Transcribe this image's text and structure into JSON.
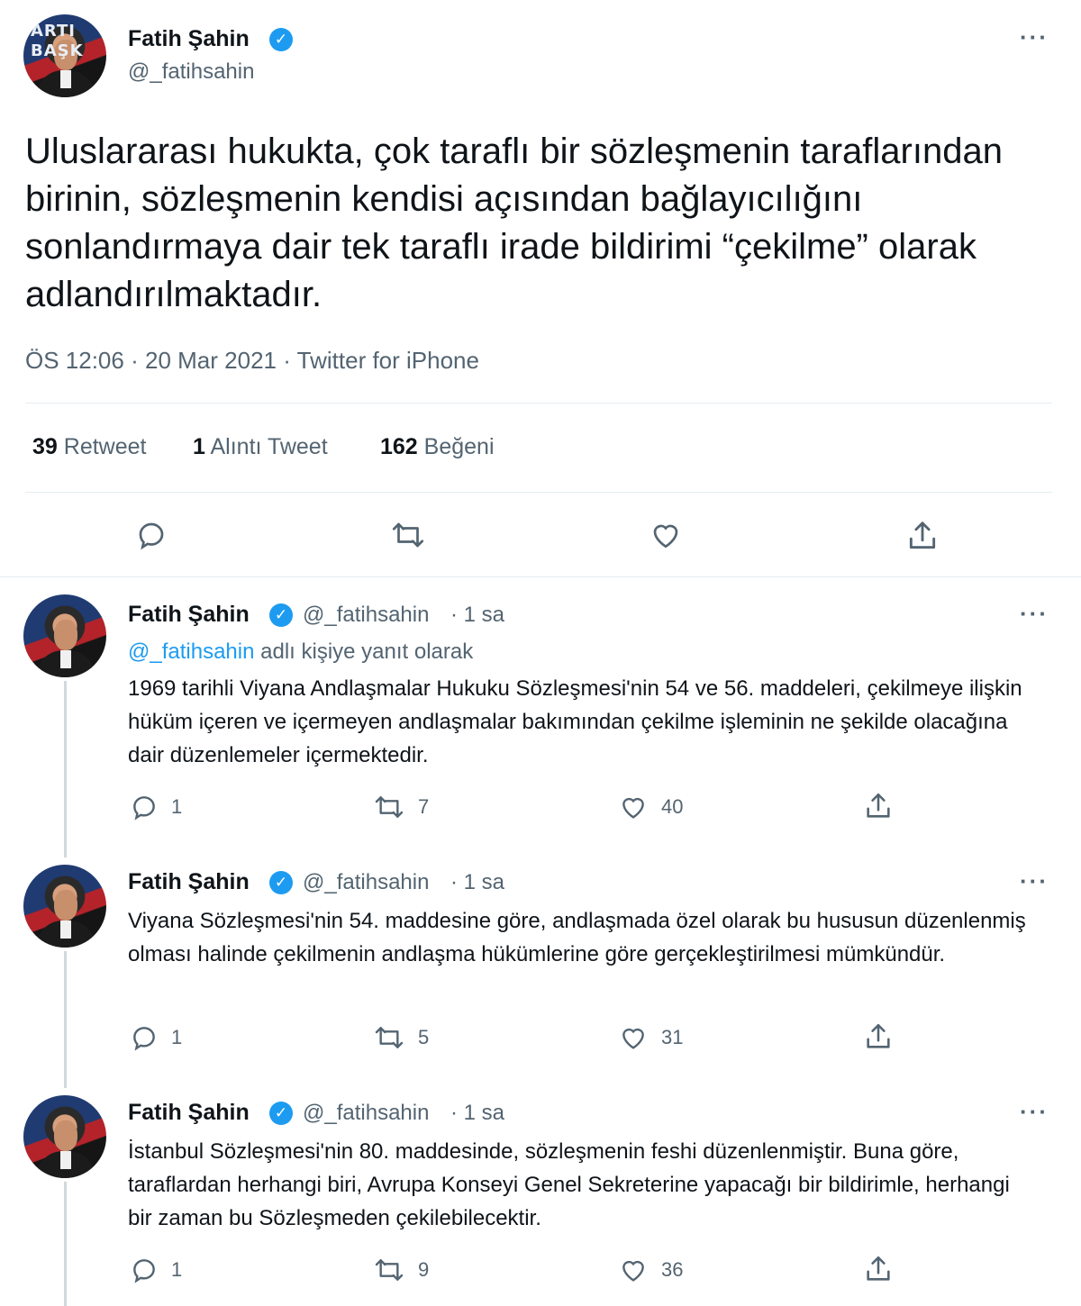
{
  "main_tweet": {
    "author_name": "Fatih Şahin",
    "handle": "@_fatihsahin",
    "avatar_text": "ARTI BAŞK",
    "text": "Uluslararası hukukta, çok taraflı bir sözleşmenin taraflarından birinin, sözleşmenin kendisi açısından bağlayıcılığını sonlandırmaya dair tek taraflı irade bildirimi “çekilme” olarak adlandırılmaktadır.",
    "time": "ÖS 12:06",
    "date": "20 Mar 2021",
    "source": "Twitter for iPhone",
    "separator": "·",
    "stats": {
      "retweet_count": "39",
      "retweet_label": "Retweet",
      "quote_count": "1",
      "quote_label": "Alıntı Tweet",
      "like_count": "162",
      "like_label": "Beğeni"
    }
  },
  "replies": [
    {
      "author_name": "Fatih Şahin",
      "handle": "@_fatihsahin",
      "time": "· 1 sa",
      "reply_to_mention": "@_fatihsahin",
      "reply_to_suffix": "adlı kişiye yanıt olarak",
      "text": "1969 tarihli Viyana Andlaşmalar Hukuku Sözleşmesi'nin 54 ve 56. maddeleri, çekilmeye ilişkin hüküm içeren ve içermeyen andlaşmalar bakımından çekilme işleminin ne şekilde olacağına dair düzenlemeler içermektedir.",
      "reply_count": "1",
      "retweet_count": "7",
      "like_count": "40"
    },
    {
      "author_name": "Fatih Şahin",
      "handle": "@_fatihsahin",
      "time": "· 1 sa",
      "text": "Viyana Sözleşmesi'nin 54. maddesine göre, andlaşmada özel olarak bu hususun düzenlenmiş olması halinde çekilmenin andlaşma hükümlerine göre gerçekleştirilmesi mümkündür.",
      "reply_count": "1",
      "retweet_count": "5",
      "like_count": "31"
    },
    {
      "author_name": "Fatih Şahin",
      "handle": "@_fatihsahin",
      "time": "· 1 sa",
      "text": "İstanbul Sözleşmesi'nin 80. maddesinde, sözleşmenin feshi düzenlenmiştir. Buna göre, taraflardan herhangi biri, Avrupa Konseyi Genel Sekreterine yapacağı bir bildirimle, herhangi bir zaman bu Sözleşmeden çekilebilecektir.",
      "reply_count": "1",
      "retweet_count": "9",
      "like_count": "36"
    }
  ],
  "icons": {
    "verified": "verified-badge-icon",
    "more": "more-dots-icon",
    "reply": "reply-bubble-icon",
    "retweet": "retweet-icon",
    "like": "heart-icon",
    "share": "share-icon"
  },
  "colors": {
    "accent": "#1d9bf0",
    "text": "#0f1419",
    "secondary": "#536471",
    "divider": "#e6ecf0"
  }
}
